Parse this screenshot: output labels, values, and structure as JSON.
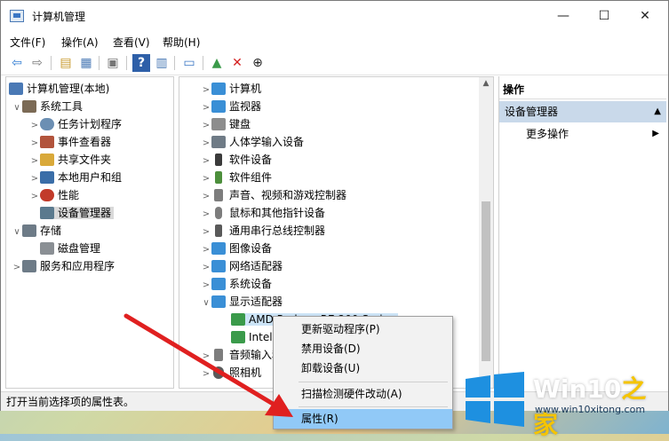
{
  "window": {
    "title": "计算机管理",
    "controls": {
      "minimize": "—",
      "maximize": "☐",
      "close": "✕"
    }
  },
  "menubar": [
    {
      "label": "文件(F)"
    },
    {
      "label": "操作(A)"
    },
    {
      "label": "查看(V)"
    },
    {
      "label": "帮助(H)"
    }
  ],
  "left_tree": [
    {
      "label": "计算机管理(本地)",
      "arrow": "",
      "color": "#4a79b5",
      "icon": "computer-management-icon"
    },
    {
      "label": "系统工具",
      "arrow": "∨",
      "color": "#7b6a55",
      "icon": "tools-icon"
    },
    {
      "label": "任务计划程序",
      "arrow": ">",
      "color": "#6c8fb3",
      "icon": "clock-icon"
    },
    {
      "label": "事件查看器",
      "arrow": ">",
      "color": "#b2543c",
      "icon": "event-viewer-icon"
    },
    {
      "label": "共享文件夹",
      "arrow": ">",
      "color": "#d9a93a",
      "icon": "shared-folder-icon"
    },
    {
      "label": "本地用户和组",
      "arrow": ">",
      "color": "#3a6ea8",
      "icon": "users-icon"
    },
    {
      "label": "性能",
      "arrow": ">",
      "color": "#c23b2a",
      "icon": "performance-icon"
    },
    {
      "label": "设备管理器",
      "arrow": "",
      "color": "#5b7a8e",
      "icon": "device-manager-icon",
      "selected": true
    },
    {
      "label": "存储",
      "arrow": "∨",
      "color": "#6d7b87",
      "icon": "storage-icon"
    },
    {
      "label": "磁盘管理",
      "arrow": "",
      "color": "#8a8f94",
      "icon": "disk-icon"
    },
    {
      "label": "服务和应用程序",
      "arrow": ">",
      "color": "#6d7b87",
      "icon": "services-icon"
    }
  ],
  "device_list": [
    {
      "label": "计算机",
      "arrow": ">",
      "color": "#3a8fd6",
      "icon": "computer-icon"
    },
    {
      "label": "监视器",
      "arrow": ">",
      "color": "#3a8fd6",
      "icon": "monitor-icon"
    },
    {
      "label": "键盘",
      "arrow": ">",
      "color": "#8d8d8d",
      "icon": "keyboard-icon"
    },
    {
      "label": "人体学输入设备",
      "arrow": ">",
      "color": "#6f7b86",
      "icon": "hid-icon"
    },
    {
      "label": "软件设备",
      "arrow": ">",
      "color": "#3b3b3b",
      "icon": "software-device-icon"
    },
    {
      "label": "软件组件",
      "arrow": ">",
      "color": "#4d8f3c",
      "icon": "software-component-icon"
    },
    {
      "label": "声音、视频和游戏控制器",
      "arrow": ">",
      "color": "#7d7d7d",
      "icon": "sound-icon"
    },
    {
      "label": "鼠标和其他指针设备",
      "arrow": ">",
      "color": "#7d7d7d",
      "icon": "mouse-icon"
    },
    {
      "label": "通用串行总线控制器",
      "arrow": ">",
      "color": "#5a5a5a",
      "icon": "usb-icon"
    },
    {
      "label": "图像设备",
      "arrow": ">",
      "color": "#3a8fd6",
      "icon": "imaging-icon"
    },
    {
      "label": "网络适配器",
      "arrow": ">",
      "color": "#3a8fd6",
      "icon": "network-icon"
    },
    {
      "label": "系统设备",
      "arrow": ">",
      "color": "#3a8fd6",
      "icon": "system-device-icon"
    },
    {
      "label": "显示适配器",
      "arrow": "∨",
      "color": "#3a8fd6",
      "icon": "display-adapter-icon"
    },
    {
      "label": "AMD Radeon R7 200 Series",
      "arrow": "",
      "color": "#3a9a4a",
      "icon": "display-card-icon",
      "selected": true
    },
    {
      "label": "Intel(R) HD Graphics",
      "arrow": "",
      "color": "#3a9a4a",
      "icon": "display-card-icon"
    },
    {
      "label": "音频输入和输出",
      "arrow": ">",
      "color": "#7d7d7d",
      "icon": "audio-icon"
    },
    {
      "label": "照相机",
      "arrow": ">",
      "color": "#5a5a5a",
      "icon": "camera-icon"
    }
  ],
  "actions": {
    "header": "操作",
    "section": "设备管理器",
    "more": "更多操作"
  },
  "context_menu": [
    {
      "label": "更新驱动程序(P)"
    },
    {
      "label": "禁用设备(D)"
    },
    {
      "label": "卸载设备(U)"
    },
    {
      "label": "扫描检测硬件改动(A)"
    },
    {
      "label": "属性(R)",
      "highlighted": true
    }
  ],
  "statusbar": {
    "text": "打开当前选择项的属性表。"
  },
  "watermark": {
    "brand": "Win10",
    "brand2": "之家",
    "url": "www.win10xitong.com"
  }
}
